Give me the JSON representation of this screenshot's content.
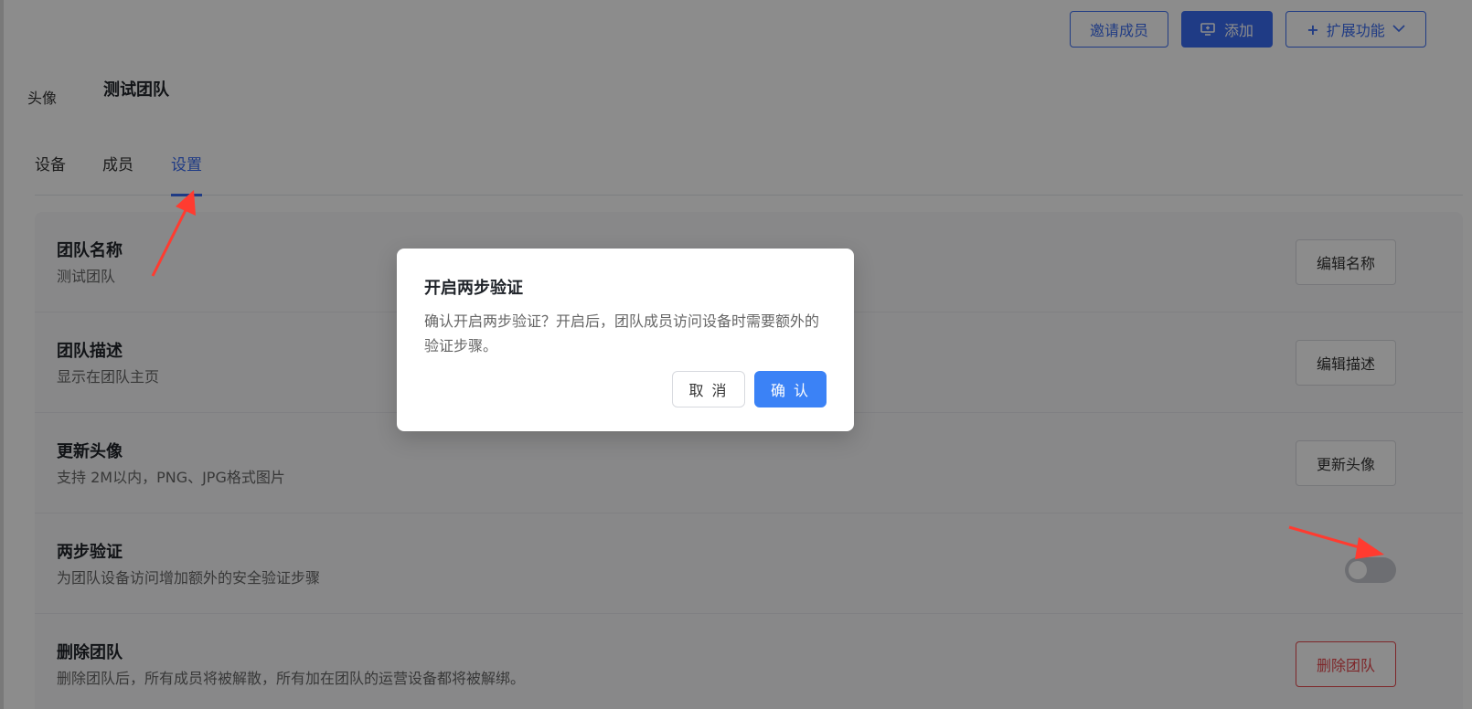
{
  "header": {
    "invite_label": "邀请成员",
    "add_label": "添加",
    "extend_label": "扩展功能",
    "avatar_label": "头像",
    "team_name": "测试团队"
  },
  "tabs": [
    {
      "label": "设备"
    },
    {
      "label": "成员"
    },
    {
      "label": "设置",
      "active": true
    }
  ],
  "settings": {
    "name": {
      "title": "团队名称",
      "desc": "测试团队",
      "button": "编辑名称"
    },
    "description": {
      "title": "团队描述",
      "desc": "显示在团队主页",
      "button": "编辑描述"
    },
    "avatar": {
      "title": "更新头像",
      "desc": "支持 2M以内，PNG、JPG格式图片",
      "button": "更新头像"
    },
    "two_factor": {
      "title": "两步验证",
      "desc": "为团队设备访问增加额外的安全验证步骤",
      "enabled": false
    },
    "delete": {
      "title": "删除团队",
      "desc": "删除团队后，所有成员将被解散，所有加在团队的运营设备都将被解绑。",
      "button": "删除团队"
    }
  },
  "dialog": {
    "title": "开启两步验证",
    "body": "确认开启两步验证？开启后，团队成员访问设备时需要额外的验证步骤。",
    "cancel_label": "取 消",
    "confirm_label": "确 认"
  },
  "colors": {
    "primary": "#3a6cf2",
    "danger": "#e5484d",
    "annotation": "#ff3b30"
  }
}
